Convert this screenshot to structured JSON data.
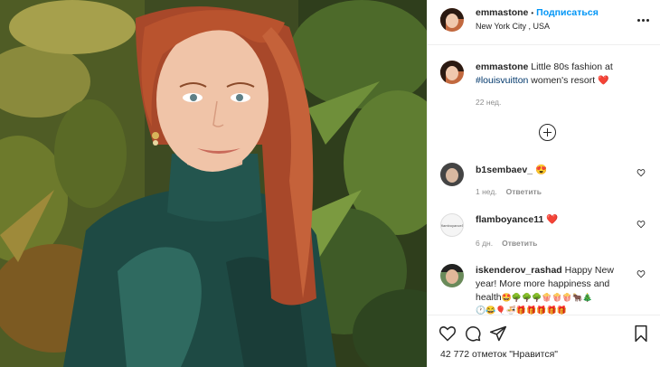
{
  "header": {
    "username": "emmastone",
    "separator": "•",
    "follow_label": "Подписаться",
    "location": "New York City , USA"
  },
  "caption": {
    "username": "emmastone",
    "text_before": "Little 80s fashion at",
    "hashtag": "#louisvuitton",
    "text_after": "women's resort",
    "emoji": "❤️",
    "time": "22 нед."
  },
  "comments": [
    {
      "username": "b1sembaev_",
      "text": "😍",
      "time": "1 нед.",
      "reply_label": "Ответить"
    },
    {
      "username": "flamboyance11",
      "text": "❤️",
      "time": "6 дн.",
      "reply_label": "Ответить",
      "avatar_text": "flamboyance11"
    },
    {
      "username": "iskenderov_rashad",
      "text": "Happy New year! More more happiness and health",
      "emoji_line": "🤩🌳🌳🌳🍿🍿🍿🐂🎄",
      "emoji_line2": "🕐😂🎈🍜🎁🎁🎁🎁🎁"
    }
  ],
  "actions": {
    "likes_text": "42 772 отметок \"Нравится\""
  },
  "colors": {
    "link_blue": "#0095f6",
    "hashtag": "#00376b",
    "muted": "#8e8e8e",
    "heart": "#ed4956"
  },
  "icons": [
    "more-icon",
    "add-comments-icon",
    "heart-icon",
    "comment-icon",
    "share-icon",
    "bookmark-icon"
  ]
}
